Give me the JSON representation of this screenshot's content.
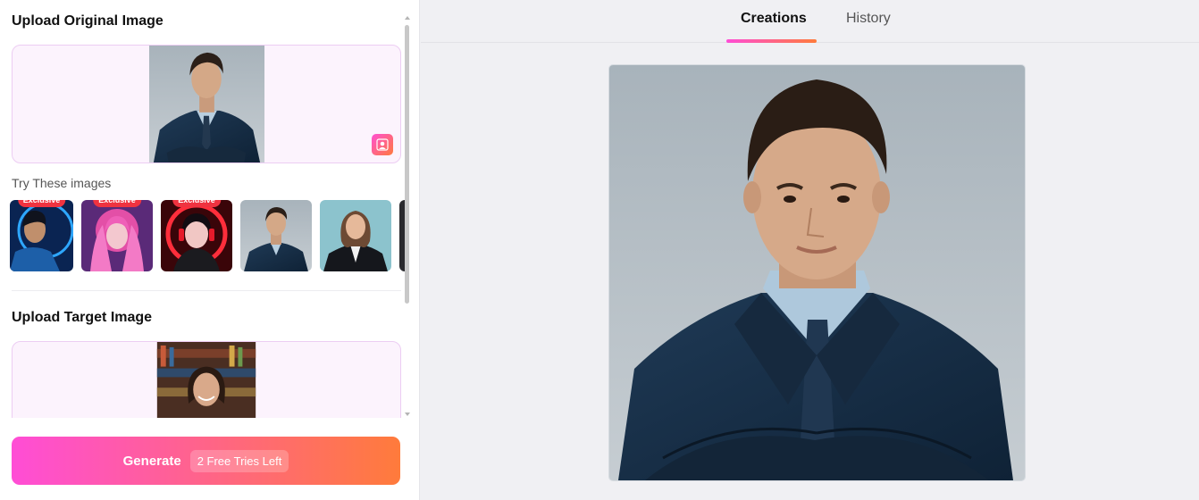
{
  "left_panel": {
    "original": {
      "title": "Upload Original Image"
    },
    "try_label": "Try These images",
    "samples": [
      {
        "name": "sample-cyber-man",
        "badge": "Exclusive"
      },
      {
        "name": "sample-pink-fairy",
        "badge": "Exclusive"
      },
      {
        "name": "sample-red-headphones",
        "badge": "Exclusive"
      },
      {
        "name": "sample-businessman",
        "badge": ""
      },
      {
        "name": "sample-businesswoman",
        "badge": ""
      }
    ],
    "target": {
      "title": "Upload Target Image"
    }
  },
  "generate": {
    "label": "Generate",
    "tries": "2 Free Tries Left"
  },
  "tabs": {
    "active": "Creations",
    "other": "History"
  },
  "colors": {
    "accent_start": "#ff4dd6",
    "accent_end": "#ff7b3b",
    "badge": "#ef3340"
  },
  "icons": {
    "swap": "person-swap-icon"
  }
}
